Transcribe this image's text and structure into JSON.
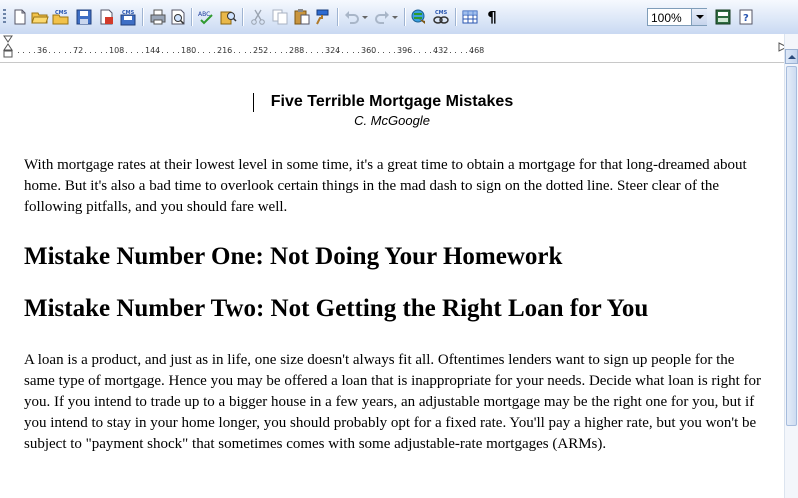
{
  "toolbar": {
    "buttons": [
      {
        "icon": "new-document-icon"
      },
      {
        "icon": "open-folder-icon"
      },
      {
        "icon": "open-cms-icon"
      },
      {
        "icon": "save-icon"
      },
      {
        "icon": "permission-icon"
      },
      {
        "icon": "save-cms-icon"
      },
      {
        "icon": "print-icon"
      },
      {
        "icon": "print-preview-icon"
      },
      {
        "icon": "spelling-icon"
      },
      {
        "icon": "research-icon"
      },
      {
        "icon": "cut-icon"
      },
      {
        "icon": "copy-icon"
      },
      {
        "icon": "paste-icon"
      },
      {
        "icon": "format-painter-icon"
      },
      {
        "icon": "undo-icon"
      },
      {
        "icon": "redo-icon"
      },
      {
        "icon": "hyperlink-icon"
      },
      {
        "icon": "cms-link-icon"
      },
      {
        "icon": "table-icon"
      },
      {
        "icon": "show-formatting-icon"
      },
      {
        "icon": "read-icon"
      },
      {
        "icon": "help-icon"
      }
    ],
    "cms_label": "CMS",
    "pilcrow": "¶",
    "zoom_value": "100%"
  },
  "ruler": {
    "labels": [
      "36",
      "72",
      "108",
      "144",
      "180",
      "216",
      "252",
      "288",
      "324",
      "360",
      "396",
      "432",
      "468"
    ]
  },
  "document": {
    "title": "Five Terrible Mortgage Mistakes",
    "author": "C. McGoogle",
    "intro": "With mortgage rates at their lowest level in some time, it's a great time to obtain a mortgage for that long-dreamed about home. But it's also a bad time to overlook certain things in the mad dash to sign on the dotted line. Steer clear of the following pitfalls, and you should fare well.",
    "heading1": "Mistake Number One: Not Doing Your Homework",
    "heading2": "Mistake Number Two: Not Getting the Right Loan for You",
    "para2": "A loan is a product, and just as in life, one size doesn't always fit all. Oftentimes lenders want to sign up people for the same type of mortgage. Hence you may be offered a loan that is inappropriate for your needs. Decide what loan is right for you. If you intend to trade up to a bigger house in a few years, an adjustable mortgage may be the right one for you, but if you intend to stay in your home longer, you should probably opt for a fixed rate. You'll pay a higher rate, but you won't be subject to \"payment shock\" that sometimes comes with some adjustable-rate mortgages (ARMs)."
  }
}
